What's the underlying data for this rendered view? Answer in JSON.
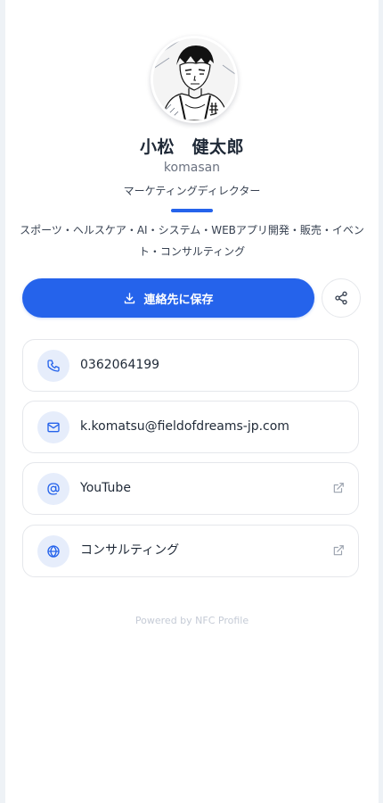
{
  "profile": {
    "name": "小松　健太郎",
    "handle": "komasan",
    "title": "マーケティングディレクター",
    "bio": "スポーツ・ヘルスケア・AI・システム・WEBアプリ開発・販売・イベント・コンサルティング"
  },
  "actions": {
    "save_label": "連絡先に保存",
    "save_icon": "download-icon",
    "share_icon": "share-icon"
  },
  "links": [
    {
      "label": "0362064199",
      "icon": "phone-icon",
      "external": false
    },
    {
      "label": "k.komatsu@fieldofdreams-jp.com",
      "icon": "mail-icon",
      "external": false
    },
    {
      "label": "YouTube",
      "icon": "at-sign-icon",
      "external": true
    },
    {
      "label": "コンサルティング",
      "icon": "globe-icon",
      "external": true
    }
  ],
  "footer": {
    "text": "Powered by NFC Profile"
  },
  "colors": {
    "accent": "#2563eb",
    "icon_background": "#e6edfb",
    "card_border": "#e5e7eb",
    "footer_text": "#c5cbd6"
  }
}
